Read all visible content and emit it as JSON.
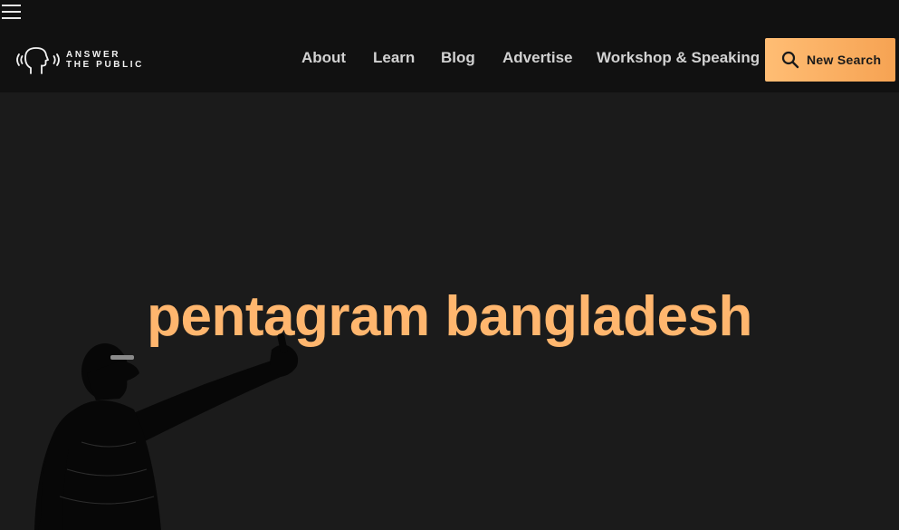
{
  "header": {
    "logo": {
      "line1": "ANSWER",
      "line2": "THE PUBLIC"
    },
    "nav": [
      {
        "label": "About"
      },
      {
        "label": "Learn"
      },
      {
        "label": "Blog"
      },
      {
        "label": "Advertise"
      },
      {
        "label": "Workshop & Speaking"
      }
    ],
    "cta": {
      "label": "New Search",
      "icon": "search-icon"
    }
  },
  "main": {
    "keyword": "pentagram bangladesh"
  },
  "colors": {
    "background": "#1b1b1b",
    "header_background": "#111111",
    "accent": "#ffb66e",
    "cta_gradient_start": "#ffbd74",
    "cta_gradient_end": "#f6a353"
  }
}
